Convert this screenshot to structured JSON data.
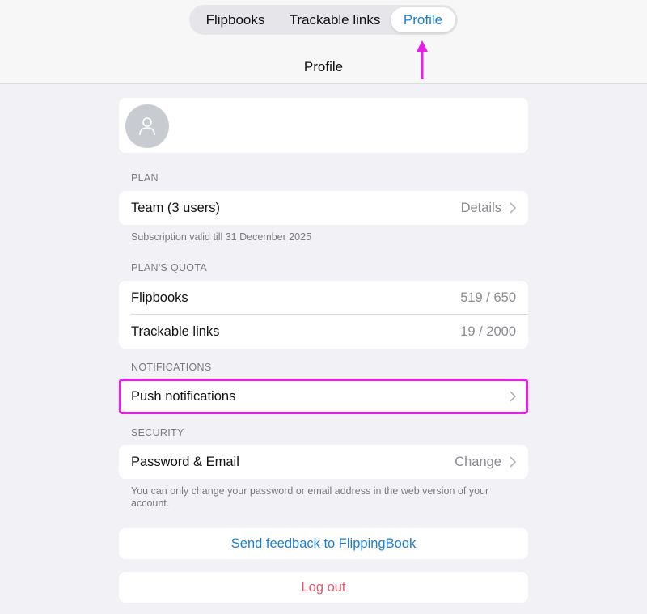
{
  "tabs": [
    {
      "label": "Flipbooks"
    },
    {
      "label": "Trackable links"
    },
    {
      "label": "Profile",
      "selected": true
    }
  ],
  "nav": {
    "title": "Profile"
  },
  "plan": {
    "section": "PLAN",
    "name": "Team (3 users)",
    "details": "Details",
    "note": "Subscription valid till 31 December 2025"
  },
  "quota": {
    "section": "PLAN'S QUOTA",
    "rows": [
      {
        "label": "Flipbooks",
        "value": "519 / 650"
      },
      {
        "label": "Trackable links",
        "value": "19 / 2000"
      }
    ]
  },
  "notifications": {
    "section": "NOTIFICATIONS",
    "push_label": "Push notifications"
  },
  "security": {
    "section": "SECURITY",
    "label": "Password & Email",
    "action": "Change",
    "note": "You can only change your password or email address in the web version of your account."
  },
  "actions": {
    "feedback": "Send feedback to FlippingBook",
    "logout": "Log out"
  },
  "colors": {
    "accent": "#1a7ed6",
    "destructive": "#e8546a",
    "annotation": "#e81ee8",
    "background": "#f2f2f6"
  },
  "icons": [
    "person-icon",
    "chevron-right-icon",
    "arrow-up-icon"
  ]
}
